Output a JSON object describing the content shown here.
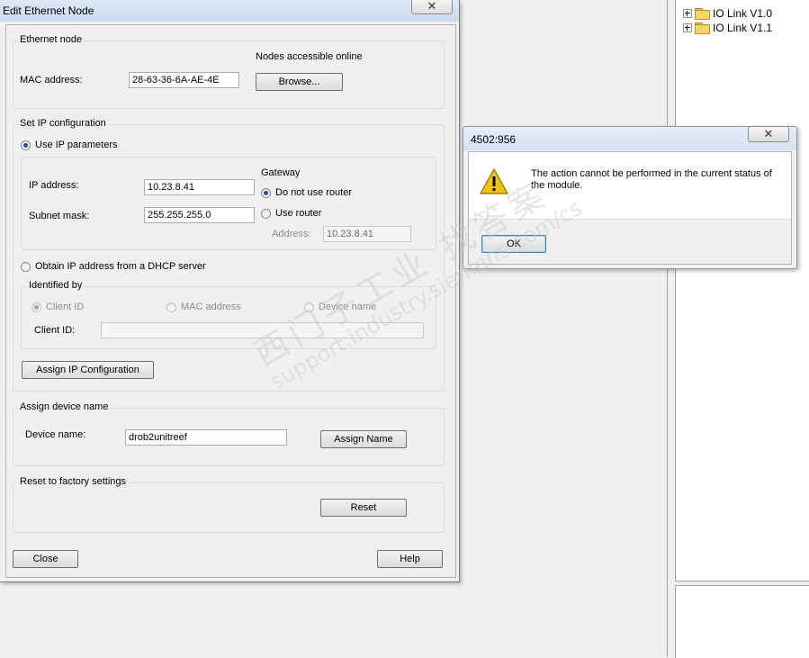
{
  "tree": {
    "items": [
      {
        "label": "IO Link V1.0"
      },
      {
        "label": "IO Link V1.1"
      }
    ]
  },
  "dialog": {
    "title": "Edit Ethernet Node",
    "close_glyph": "✕",
    "ethernet_node": {
      "legend": "Ethernet node",
      "mac_label": "MAC address:",
      "mac_value": "28-63-36-6A-AE-4E",
      "online_label": "Nodes accessible online",
      "browse_label": "Browse..."
    },
    "ip_config": {
      "legend": "Set IP configuration",
      "use_ip_label": "Use IP parameters",
      "ip_label": "IP address:",
      "ip_value": "10.23.8.41",
      "subnet_label": "Subnet mask:",
      "subnet_value": "255.255.255.0",
      "gateway_label": "Gateway",
      "no_router_label": "Do not use router",
      "use_router_label": "Use router",
      "router_address_label": "Address:",
      "router_address_value": "10.23.8.41",
      "dhcp_label": "Obtain IP address from a DHCP server",
      "identified_by_legend": "Identified by",
      "client_id_option": "Client ID",
      "mac_option": "MAC address",
      "device_name_option": "Device name",
      "client_id_label": "Client ID:",
      "client_id_value": "",
      "assign_ip_label": "Assign IP Configuration"
    },
    "device_name": {
      "legend": "Assign device name",
      "label": "Device name:",
      "value": "drob2unitreef",
      "assign_label": "Assign Name"
    },
    "reset": {
      "legend": "Reset to factory settings",
      "button_label": "Reset"
    },
    "footer": {
      "close_label": "Close",
      "help_label": "Help"
    }
  },
  "message": {
    "title": "4502:956",
    "close_glyph": "✕",
    "text": "The action cannot be performed in the current status of the module.",
    "ok_label": "OK",
    "icon": "warning-icon",
    "icon_color": "#f5c400"
  },
  "watermark": {
    "cn": "西门子工业 找答案",
    "url": "support.industry.siemens.com/cs"
  }
}
